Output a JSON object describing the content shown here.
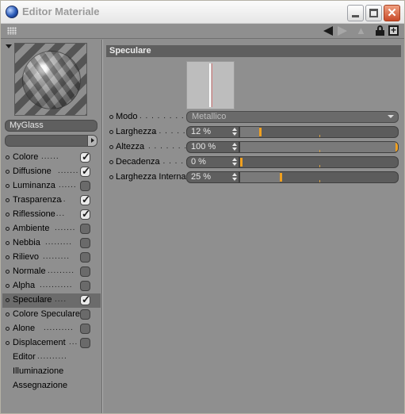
{
  "window": {
    "title": "Editor Materiale"
  },
  "toolbar": {
    "icons": [
      "grip-icon",
      "back-arrow-icon",
      "forward-arrow-icon",
      "up-arrow-icon",
      "lock-icon",
      "new-window-icon"
    ]
  },
  "material": {
    "name": "MyGlass",
    "channels": [
      {
        "label": "Colore",
        "dots": "......",
        "checked": true
      },
      {
        "label": "Diffusione",
        "dots": ".......",
        "checked": true
      },
      {
        "label": "Luminanza",
        "dots": "......",
        "checked": false
      },
      {
        "label": "Trasparenza",
        "dots": "..",
        "checked": true
      },
      {
        "label": "Riflessione",
        "dots": "....",
        "checked": true
      },
      {
        "label": "Ambiente",
        "dots": ".......",
        "checked": false
      },
      {
        "label": "Nebbia",
        "dots": ".........",
        "checked": false
      },
      {
        "label": "Rilievo",
        "dots": ".........",
        "checked": false
      },
      {
        "label": "Normale",
        "dots": ".........",
        "checked": false
      },
      {
        "label": "Alpha",
        "dots": "...........",
        "checked": false
      },
      {
        "label": "Speculare",
        "dots": "....",
        "checked": true
      },
      {
        "label": "Colore Speculare",
        "dots": "",
        "checked": false
      },
      {
        "label": "Alone",
        "dots": "..........",
        "checked": false
      },
      {
        "label": "Displacement",
        "dots": "...",
        "checked": false
      },
      {
        "label": "Editor",
        "dots": ".........."
      },
      {
        "label": "Illuminazione"
      },
      {
        "label": "Assegnazione"
      }
    ],
    "selected_channel": "Speculare"
  },
  "specular": {
    "section_title": "Speculare",
    "modo": {
      "label": "Modo",
      "dots": ". . . . . . . . . .",
      "value": "Metallico"
    },
    "params": [
      {
        "label": "Larghezza",
        "dots": ". . . . . .",
        "value": "12 %",
        "level": 0.12
      },
      {
        "label": "Altezza",
        "dots": ". . . . . . . . .",
        "value": "100 %",
        "level": 1.0
      },
      {
        "label": "Decadenza",
        "dots": ". . . . . .",
        "value": "0 %",
        "level": 0.0
      },
      {
        "label": "Larghezza Interna",
        "dots": "",
        "value": "25 %",
        "level": 0.25
      }
    ]
  }
}
